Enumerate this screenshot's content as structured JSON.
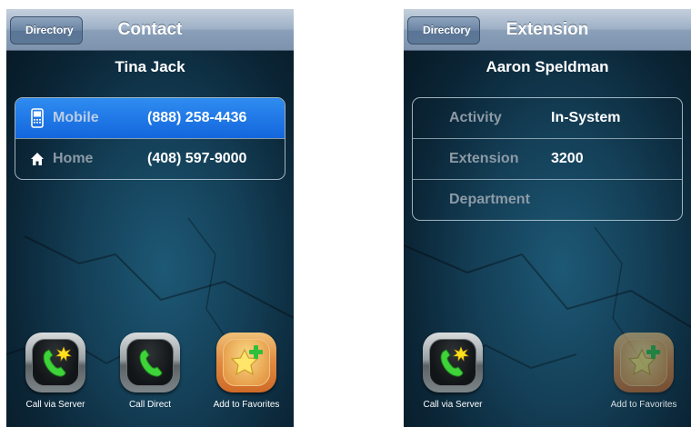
{
  "screens": {
    "left": {
      "back_label": "Directory",
      "title": "Contact",
      "name": "Tina Jack",
      "rows": [
        {
          "icon": "mobile-phone-icon",
          "label": "Mobile",
          "value": "(888) 258-4436",
          "selected": true
        },
        {
          "icon": "home-icon",
          "label": "Home",
          "value": "(408) 597-9000",
          "selected": false
        }
      ],
      "toolbar": [
        {
          "icon": "call-via-server-icon",
          "label": "Call via Server"
        },
        {
          "icon": "call-direct-icon",
          "label": "Call Direct"
        },
        {
          "icon": "add-favorite-star-icon",
          "label": "Add to Favorites"
        }
      ]
    },
    "right": {
      "back_label": "Directory",
      "title": "Extension",
      "name": "Aaron Speldman",
      "rows": [
        {
          "label": "Activity",
          "value": "In-System"
        },
        {
          "label": "Extension",
          "value": "3200"
        },
        {
          "label": "Department",
          "value": ""
        }
      ],
      "toolbar": [
        {
          "icon": "call-via-server-icon",
          "label": "Call via Server"
        },
        {
          "icon": "add-favorite-star-icon",
          "label": "Add to Favorites",
          "disabled": true
        }
      ]
    }
  },
  "colors": {
    "selected_row": "#1a6fe3",
    "nav_bar": "#9eb1c7",
    "background": "#143f57"
  }
}
